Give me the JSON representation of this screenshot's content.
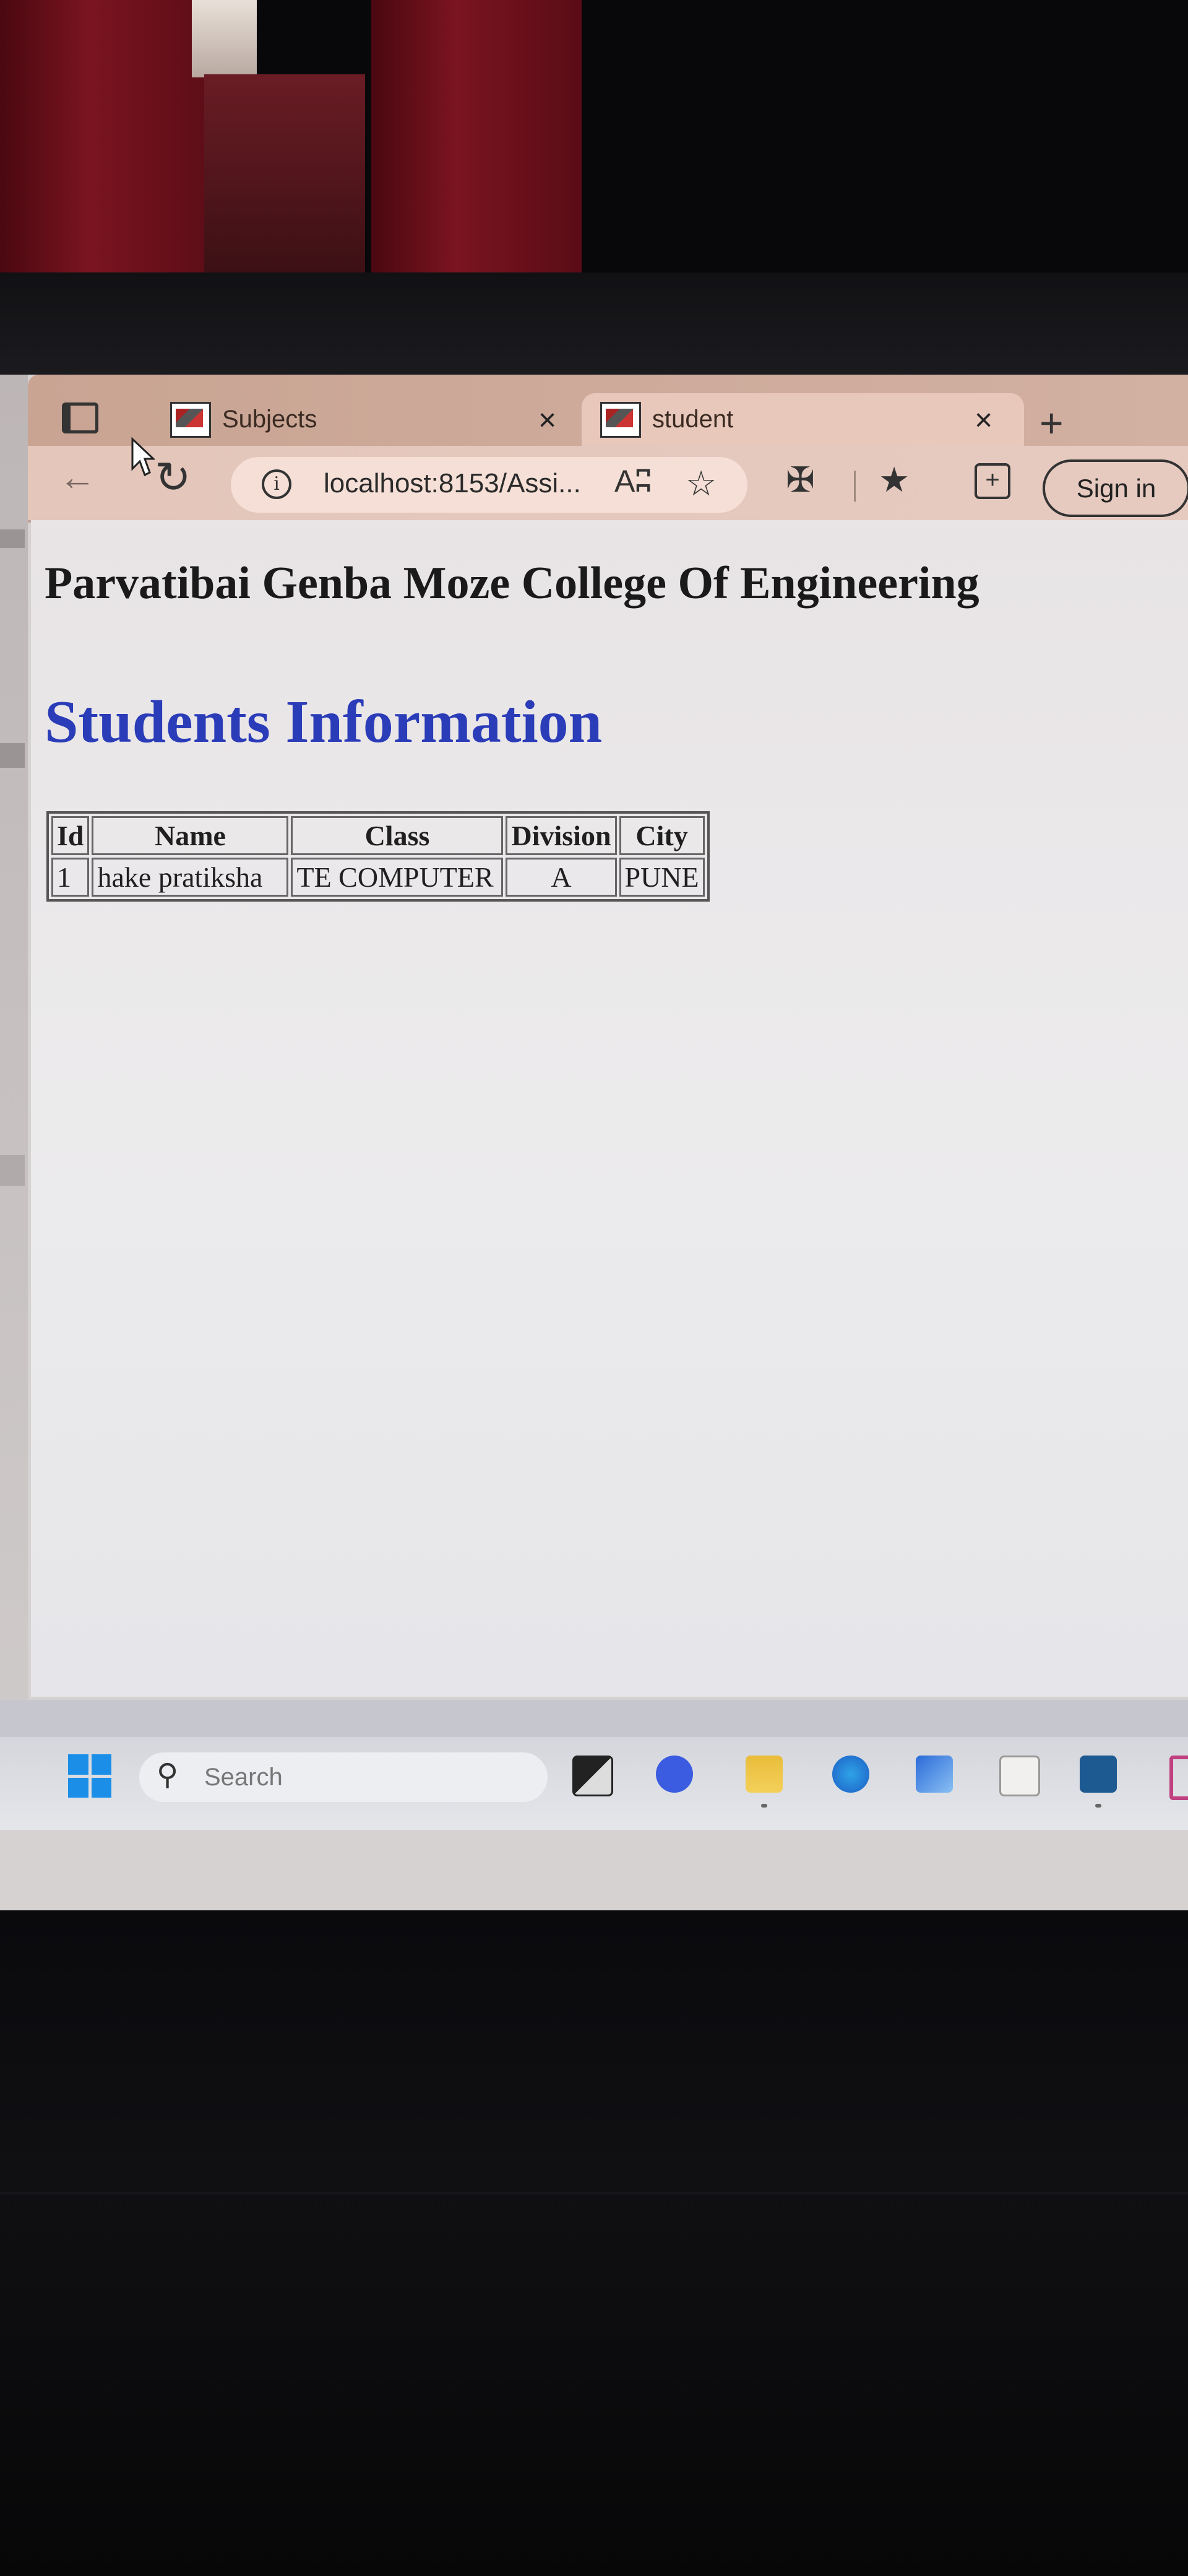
{
  "browser": {
    "tabs": [
      {
        "label": "Subjects",
        "close": "×"
      },
      {
        "label": "student",
        "close": "×"
      }
    ],
    "new_tab": "+",
    "address": "localhost:8153/Assi...",
    "read_aloud": "Aʭ",
    "sign_in": "Sign in"
  },
  "page": {
    "college": "Parvatibai Genba Moze College Of Engineering",
    "heading": "Students Information",
    "table": {
      "headers": [
        "Id",
        "Name",
        "Class",
        "Division",
        "City"
      ],
      "rows": [
        [
          "1",
          "hake pratiksha",
          "TE COMPUTER",
          "A",
          "PUNE"
        ]
      ]
    }
  },
  "taskbar": {
    "search_placeholder": "Search",
    "accent": "#1b8ee8"
  },
  "colors": {
    "heading": "#2a3cb8",
    "tab_active": "#e9c8bc"
  }
}
